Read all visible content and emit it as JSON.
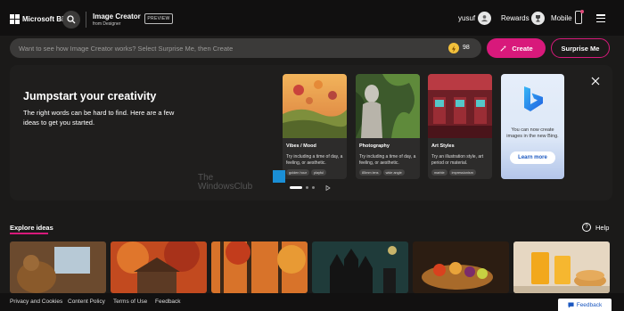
{
  "header": {
    "brand": "Microsoft Bing",
    "product_title": "Image Creator",
    "product_subtitle": "from Designer",
    "preview_badge": "PREVIEW",
    "user_name": "yusuf",
    "rewards_label": "Rewards",
    "mobile_label": "Mobile"
  },
  "prompt": {
    "placeholder": "Want to see how Image Creator works? Select Surprise Me, then Create",
    "boosts_count": "98",
    "create_label": "Create",
    "surprise_label": "Surprise Me"
  },
  "jumpstart": {
    "title": "Jumpstart your creativity",
    "subtitle": "The right words can be hard to find. Here are a few ideas to get you started.",
    "cards": [
      {
        "title": "Vibes / Mood",
        "description": "Try including a time of day, a feeling, or aesthetic.",
        "chips": [
          "golden hour",
          "playful"
        ]
      },
      {
        "title": "Photography",
        "description": "Try including a time of day, a feeling, or aesthetic.",
        "chips": [
          "85mm lens",
          "wide angle"
        ]
      },
      {
        "title": "Art Styles",
        "description": "Try an illustration style, art period or material.",
        "chips": [
          "marble",
          "impressionism"
        ]
      }
    ],
    "promo_text": "You can now create images in the new Bing.",
    "learn_more_label": "Learn more"
  },
  "watermark": {
    "line1": "The",
    "line2": "WindowsClub"
  },
  "explore": {
    "title": "Explore ideas",
    "help_label": "Help"
  },
  "footer": {
    "links": [
      "Privacy and Cookies",
      "Content Policy",
      "Terms of Use",
      "Feedback"
    ],
    "feedback_button": "Feedback"
  },
  "colors": {
    "accent": "#d8197b",
    "background": "#1b1a19",
    "bar": "#3b3a39"
  },
  "icons": [
    "search-icon",
    "user-icon",
    "rewards-icon",
    "phone-icon",
    "menu-icon",
    "coin-icon",
    "sparkle-icon",
    "close-icon",
    "bing-logo",
    "play-icon",
    "help-icon",
    "chat-icon"
  ]
}
